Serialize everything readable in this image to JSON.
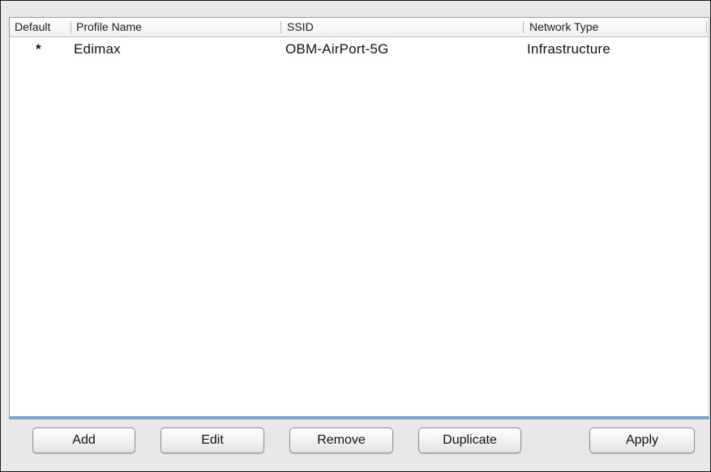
{
  "table": {
    "columns": [
      "Default",
      "Profile Name",
      "SSID",
      "Network Type"
    ],
    "rows": [
      {
        "default": "*",
        "profile_name": "Edimax",
        "ssid": "OBM-AirPort-5G",
        "network_type": "Infrastructure"
      }
    ]
  },
  "buttons": {
    "add": "Add",
    "edit": "Edit",
    "remove": "Remove",
    "duplicate": "Duplicate",
    "apply": "Apply"
  },
  "colors": {
    "focus_ring": "#7da6d8",
    "window_background": "#e8e8e8"
  }
}
